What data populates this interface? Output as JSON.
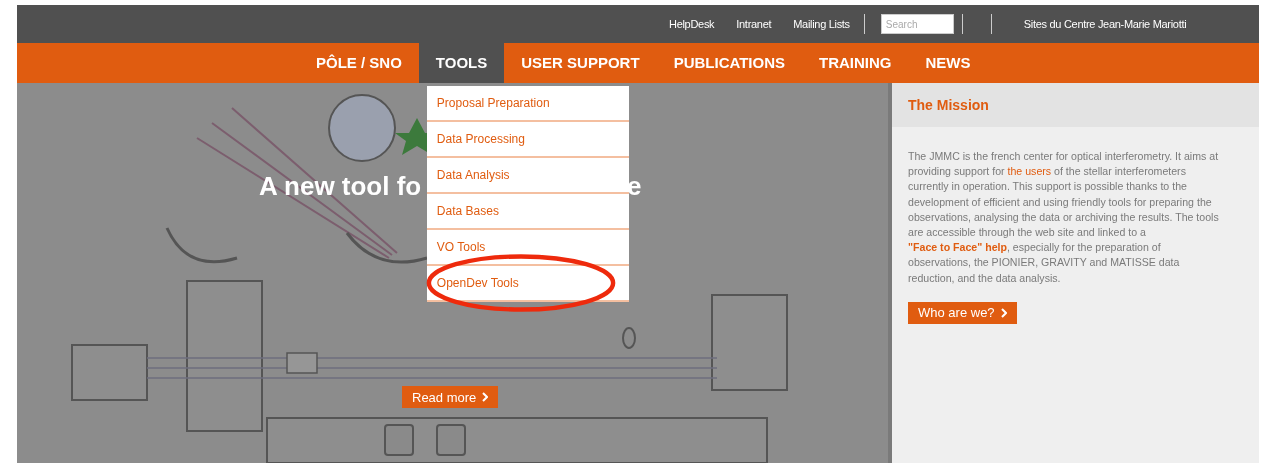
{
  "top_bar": {
    "links": [
      "HelpDesk",
      "Intranet",
      "Mailing Lists"
    ],
    "search": {
      "placeholder": "Search"
    },
    "site_link": "Sites du Centre Jean-Marie Mariotti"
  },
  "nav": {
    "items": [
      {
        "label": "PÔLE / SNO",
        "selected": false
      },
      {
        "label": "TOOLS",
        "selected": true
      },
      {
        "label": "USER SUPPORT",
        "selected": false
      },
      {
        "label": "PUBLICATIONS",
        "selected": false
      },
      {
        "label": "TRAINING",
        "selected": false
      },
      {
        "label": "NEWS",
        "selected": false
      }
    ]
  },
  "dropdown": {
    "items": [
      {
        "label": "Proposal Preparation",
        "highlighted": false
      },
      {
        "label": "Data Processing",
        "highlighted": false
      },
      {
        "label": "Data Analysis",
        "highlighted": false
      },
      {
        "label": "Data Bases",
        "highlighted": false
      },
      {
        "label": "VO Tools",
        "highlighted": false
      },
      {
        "label": "OpenDev Tools",
        "highlighted": true
      }
    ]
  },
  "hero": {
    "kind": "picture",
    "title_parts": [
      "A new tool fo",
      "e"
    ],
    "button": "Read more"
  },
  "sidebar": {
    "title": "The Mission",
    "paragraph": [
      {
        "kind": "text",
        "text": "The JMMC is the french center for optical interferometry. It aims at providing support for "
      },
      {
        "kind": "link",
        "text": "the users",
        "bold": false
      },
      {
        "kind": "text",
        "text": " of the stellar interferometers currently in operation. This support is possible thanks to the development of efficient and using friendly tools for preparing the observations, analysing the data or archiving the results. The tools are accessible through the web site and linked to a "
      },
      {
        "kind": "link",
        "text": "\"Face to Face\" help",
        "bold": true
      },
      {
        "kind": "text",
        "text": ", especially for the preparation of observations, the PIONIER, GRAVITY and MATISSE data reduction, and the data analysis."
      }
    ],
    "button": "Who are we?"
  }
}
